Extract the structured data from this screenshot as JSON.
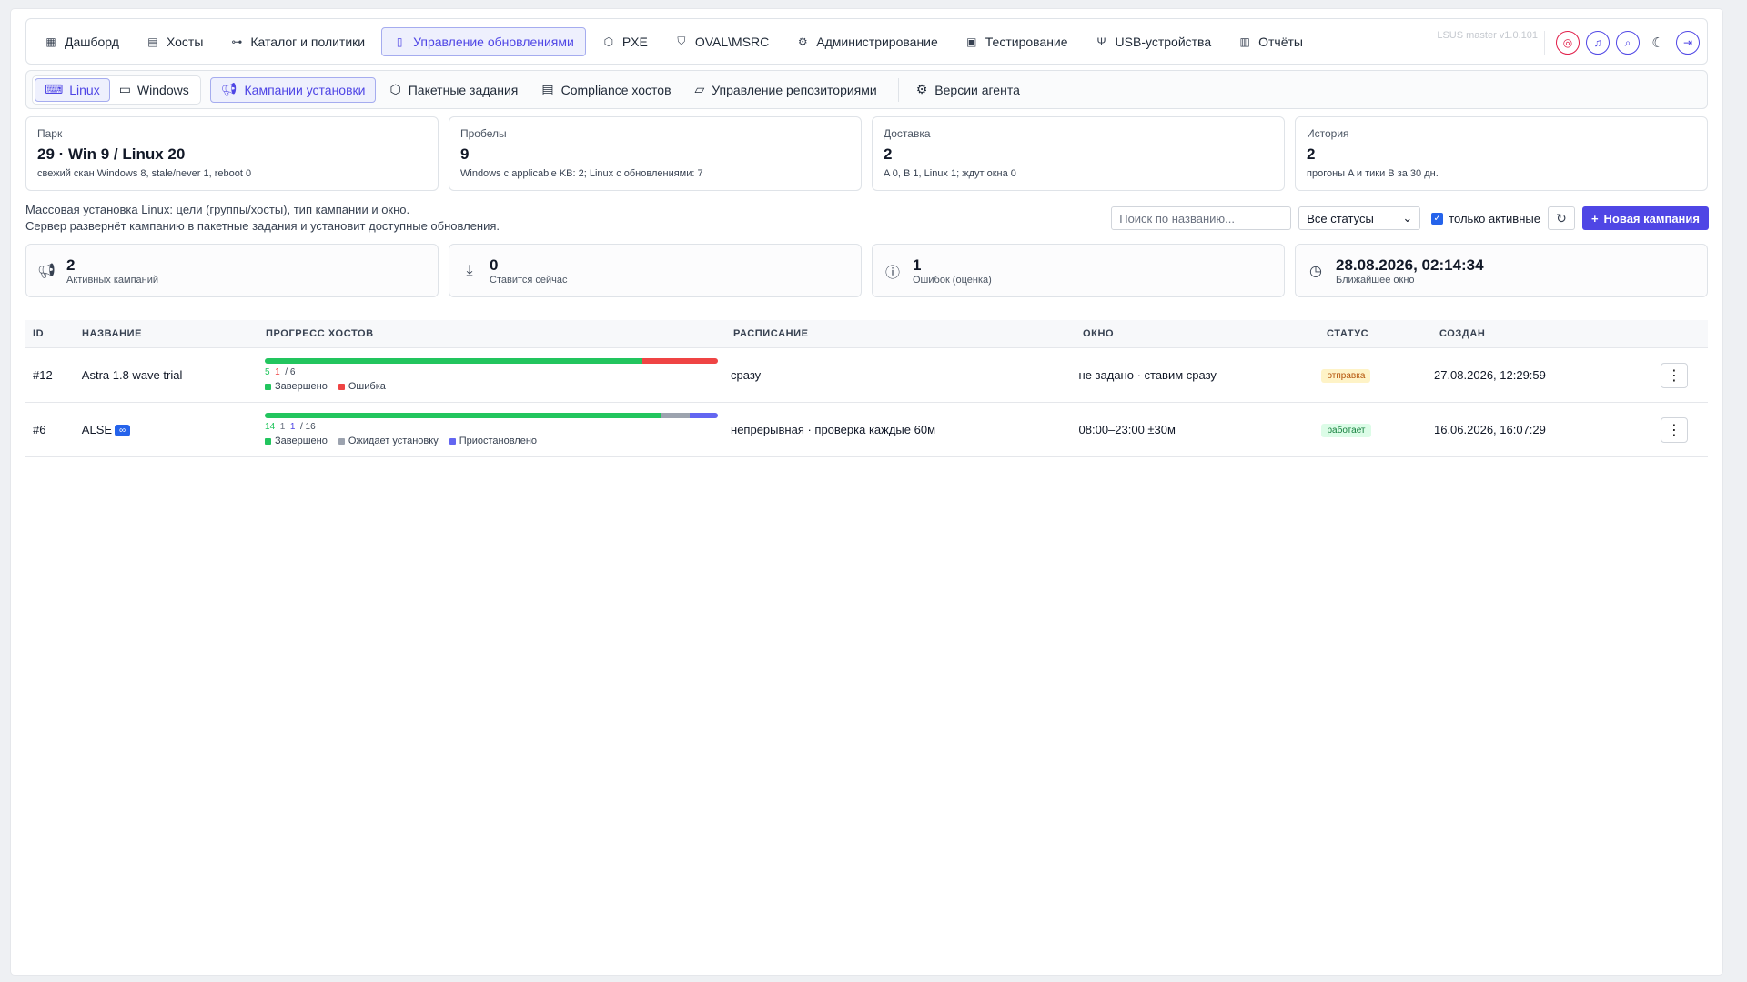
{
  "topnav": {
    "items": [
      {
        "label": "Дашборд",
        "icon": "grid-icon"
      },
      {
        "label": "Хосты",
        "icon": "server-icon"
      },
      {
        "label": "Каталог и политики",
        "icon": "tree-icon"
      },
      {
        "label": "Управление обновлениями",
        "icon": "update-icon",
        "active": true
      },
      {
        "label": "PXE",
        "icon": "cube-icon"
      },
      {
        "label": "OVAL\\MSRC",
        "icon": "shield-icon"
      },
      {
        "label": "Администрирование",
        "icon": "gear-icon"
      },
      {
        "label": "Тестирование",
        "icon": "test-icon"
      },
      {
        "label": "USB-устройства",
        "icon": "usb-icon"
      },
      {
        "label": "Отчёты",
        "icon": "report-icon"
      }
    ],
    "version": "LSUS master v1.0.101"
  },
  "subnav": {
    "os": [
      {
        "label": "Linux",
        "active": true
      },
      {
        "label": "Windows"
      }
    ],
    "items": [
      {
        "label": "Кампании установки",
        "active": true
      },
      {
        "label": "Пакетные задания"
      },
      {
        "label": "Compliance хостов"
      },
      {
        "label": "Управление репозиториями"
      },
      {
        "label": "Версии агента"
      }
    ]
  },
  "kpis": [
    {
      "label": "Парк",
      "value": "29 · Win 9 / Linux 20",
      "note": "свежий скан Windows 8, stale/never 1, reboot 0"
    },
    {
      "label": "Пробелы",
      "value": "9",
      "note": "Windows с applicable KB: 2; Linux с обновлениями: 7"
    },
    {
      "label": "Доставка",
      "value": "2",
      "note": "A 0, B 1, Linux 1; ждут окна 0"
    },
    {
      "label": "История",
      "value": "2",
      "note": "прогоны A и тики B за 30 дн."
    }
  ],
  "description": {
    "line1": "Массовая установка Linux: цели (группы/хосты), тип кампании и окно.",
    "line2": "Сервер развернёт кампанию в пакетные задания и установит доступные обновления."
  },
  "toolbar": {
    "search_placeholder": "Поиск по названию...",
    "status_select": "Все статусы",
    "only_active": "только активные",
    "new_campaign": "Новая кампания"
  },
  "stats": [
    {
      "value": "2",
      "label": "Активных кампаний",
      "icon": "megaphone-icon"
    },
    {
      "value": "0",
      "label": "Ставится сейчас",
      "icon": "download-icon"
    },
    {
      "value": "1",
      "label": "Ошибок (оценка)",
      "icon": "alert-icon"
    },
    {
      "value": "28.08.2026, 02:14:34",
      "label": "Ближайшее окно",
      "icon": "clock-icon"
    }
  ],
  "table": {
    "headers": {
      "id": "ID",
      "name": "НАЗВАНИЕ",
      "progress": "ПРОГРЕСС ХОСТОВ",
      "schedule": "РАСПИСАНИЕ",
      "window": "ОКНО",
      "status": "СТАТУС",
      "created": "СОЗДАН"
    },
    "rows": [
      {
        "id": "#12",
        "name": "Astra 1.8 wave trial",
        "done": 5,
        "failed": 1,
        "waiting": 0,
        "paused": 0,
        "total": 6,
        "done_text": "5",
        "failed_text": "1",
        "total_text": "/ 6",
        "legend_done": "Завершено",
        "legend_failed": "Ошибка",
        "schedule": "сразу",
        "window": "не задано · ставим сразу",
        "status": "отправка",
        "created": "27.08.2026, 12:29:59"
      },
      {
        "id": "#6",
        "name": "ALSE",
        "tag": "∞",
        "done": 14,
        "failed": 0,
        "waiting": 1,
        "paused": 1,
        "total": 16,
        "done_text": "14",
        "waiting_text": "1",
        "paused_text": "1",
        "total_text": "/ 16",
        "legend_done": "Завершено",
        "legend_waiting": "Ожидает установку",
        "legend_paused": "Приостановлено",
        "schedule": "непрерывная · проверка каждые 60м",
        "window": "08:00–23:00 ±30м",
        "status": "работает",
        "created": "16.06.2026, 16:07:29"
      }
    ]
  },
  "colors": {
    "accent": "#4f46e5",
    "done": "#22c55e",
    "error": "#ef4444",
    "waiting": "#9ca3af",
    "paused": "#6366f1"
  }
}
